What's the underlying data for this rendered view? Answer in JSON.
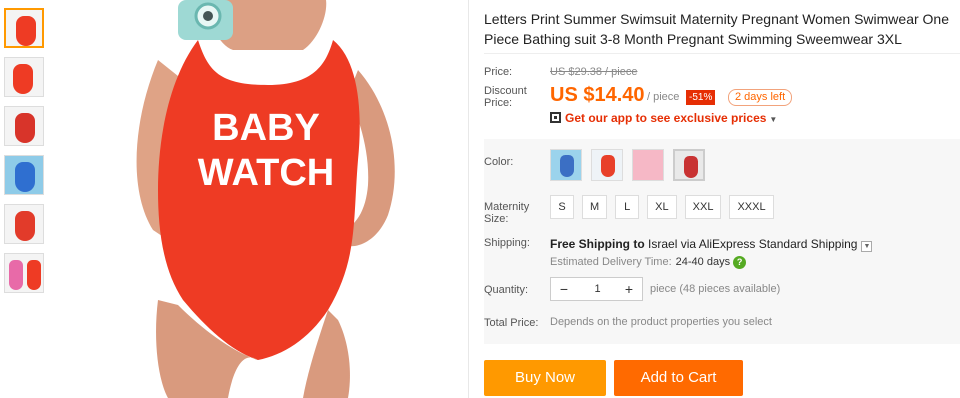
{
  "product": {
    "title": "Letters Print Summer Swimsuit Maternity Pregnant Women Swimwear One Piece Bathing suit 3-8 Month Pregnant Swimming Sweemwear 3XL",
    "image_text": "BABY WATCH"
  },
  "pricing": {
    "price_label": "Price:",
    "original_price": "US $29.38 / piece",
    "discount_label": "Discount Price:",
    "current_price": "US $14.40",
    "unit": "/ piece",
    "discount_badge": "-51%",
    "time_left": "2 days left",
    "app_promo": "Get our app to see exclusive prices"
  },
  "options": {
    "color_label": "Color:",
    "color_swatches": [
      {
        "icon": "blue-swimsuit-swatch",
        "color": "#3b6fc4"
      },
      {
        "icon": "red-swimsuit-swatch",
        "color": "#e8402a"
      },
      {
        "icon": "pink-swimsuit-swatch",
        "color": "#f6b8c6"
      },
      {
        "icon": "red-dark-swimsuit-swatch",
        "color": "#c83232"
      }
    ],
    "size_label": "Maternity Size:",
    "sizes": [
      "S",
      "M",
      "L",
      "XL",
      "XXL",
      "XXXL"
    ]
  },
  "shipping": {
    "label": "Shipping:",
    "free_text": "Free Shipping to",
    "destination": "Israel via AliExpress Standard Shipping",
    "eta_label": "Estimated Delivery Time:",
    "eta_value": "24-40 days",
    "help_glyph": "?"
  },
  "quantity": {
    "label": "Quantity:",
    "value": "1",
    "minus": "−",
    "plus": "+",
    "available": "piece (48 pieces available)"
  },
  "total": {
    "label": "Total Price:",
    "value": "Depends on the product properties you select"
  },
  "actions": {
    "buy_now": "Buy Now",
    "add_to_cart": "Add to Cart"
  },
  "colors": {
    "accent": "#ff6a00",
    "buy_now": "#ff9900",
    "price": "#ff6600",
    "discount_badge": "#e62e04",
    "swimsuit_red": "#ee3b24"
  }
}
